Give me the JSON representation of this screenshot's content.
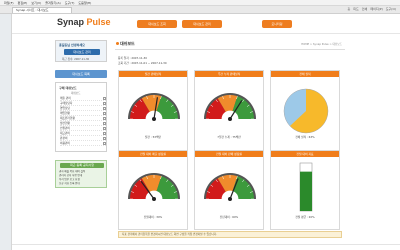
{
  "browser": {
    "menu": [
      "파일(F)",
      "편집(E)",
      "보기(V)",
      "즐겨찾기(A)",
      "도구(T)",
      "도움말(H)"
    ],
    "tab_title": "Synap 시너프 : 대시보드",
    "tab_icons": [
      "홈",
      "피드",
      "인쇄",
      "페이지(P)",
      "도구(O)"
    ]
  },
  "header": {
    "logo_main": "Synap",
    "logo_accent": "Pulse",
    "nav": [
      "대쉬보드 조회",
      "대쉬보드 관리",
      "모니터링"
    ],
    "top_links": "로그아웃 | 마이페이지"
  },
  "sidebar": {
    "login_title": "홍길동님 안녕하세요",
    "login_button": "대쉬보드 관리",
    "login_sub": "최근 접속: 2007-11-30",
    "tab_button": "대쉬보드 목록",
    "menu_header": "구매 대쉬보드",
    "menu_sub": "대쉬보드",
    "menu_items": [
      "매출 관리",
      "구매담당자",
      "영업담당",
      "매입현황",
      "제조원가현황",
      "생산현황",
      "인원관리",
      "재고관리",
      "판관비",
      "비용관리"
    ],
    "notice_title": "최근 등록 공지사항",
    "notice_items": [
      "귀사 매출 목표 대비 실적",
      "관리자 공지 사항 안내",
      "부서 업무 보고 요청",
      "신규 지표 등록 안내"
    ]
  },
  "main": {
    "title": "대쉬보드",
    "breadcrumb": "HOME > Synap Pulse > 대쉬보드",
    "info1": "등록 일자 : 2007-11-30",
    "info2": "조회 기간 : 2007-11-01 ~ 2007-11-30",
    "cards": [
      {
        "title": "월간 판매실적",
        "label": "월간 : 53백만",
        "type": "gauge",
        "value": 0.55
      },
      {
        "title": "주간 누적 판매실적",
        "label": "7일간 누계 : 75백만",
        "type": "gauge",
        "value": 0.68
      },
      {
        "title": "전체 실적",
        "label": "전체 실적 : 63%",
        "type": "pie",
        "value": 0.63
      },
      {
        "title": "전월 대비 매출 성장률",
        "label": "전월대비 : 30%",
        "type": "gauge",
        "value": 0.3
      },
      {
        "title": "전월 대비 판매 성장률",
        "label": "전년대비 : 60%",
        "type": "gauge",
        "value": 0.62
      },
      {
        "title": "전월 대비 지표",
        "label": "전월 평균 : 20%",
        "type": "bar",
        "value": 0.82
      }
    ],
    "footer_note": "지표 관리에서 관리항목을 변경하시면 대쉬보드 화면 구성을 직접 변경하실 수 있습니다."
  },
  "colors": {
    "accent": "#f07d1a",
    "gauge_red": "#d11b1b",
    "gauge_orange": "#f08c2c",
    "gauge_green": "#3c9a3c",
    "pie_yellow": "#f7b92b",
    "pie_blue": "#9dc9e8",
    "bar_green": "#2b8a2b"
  }
}
